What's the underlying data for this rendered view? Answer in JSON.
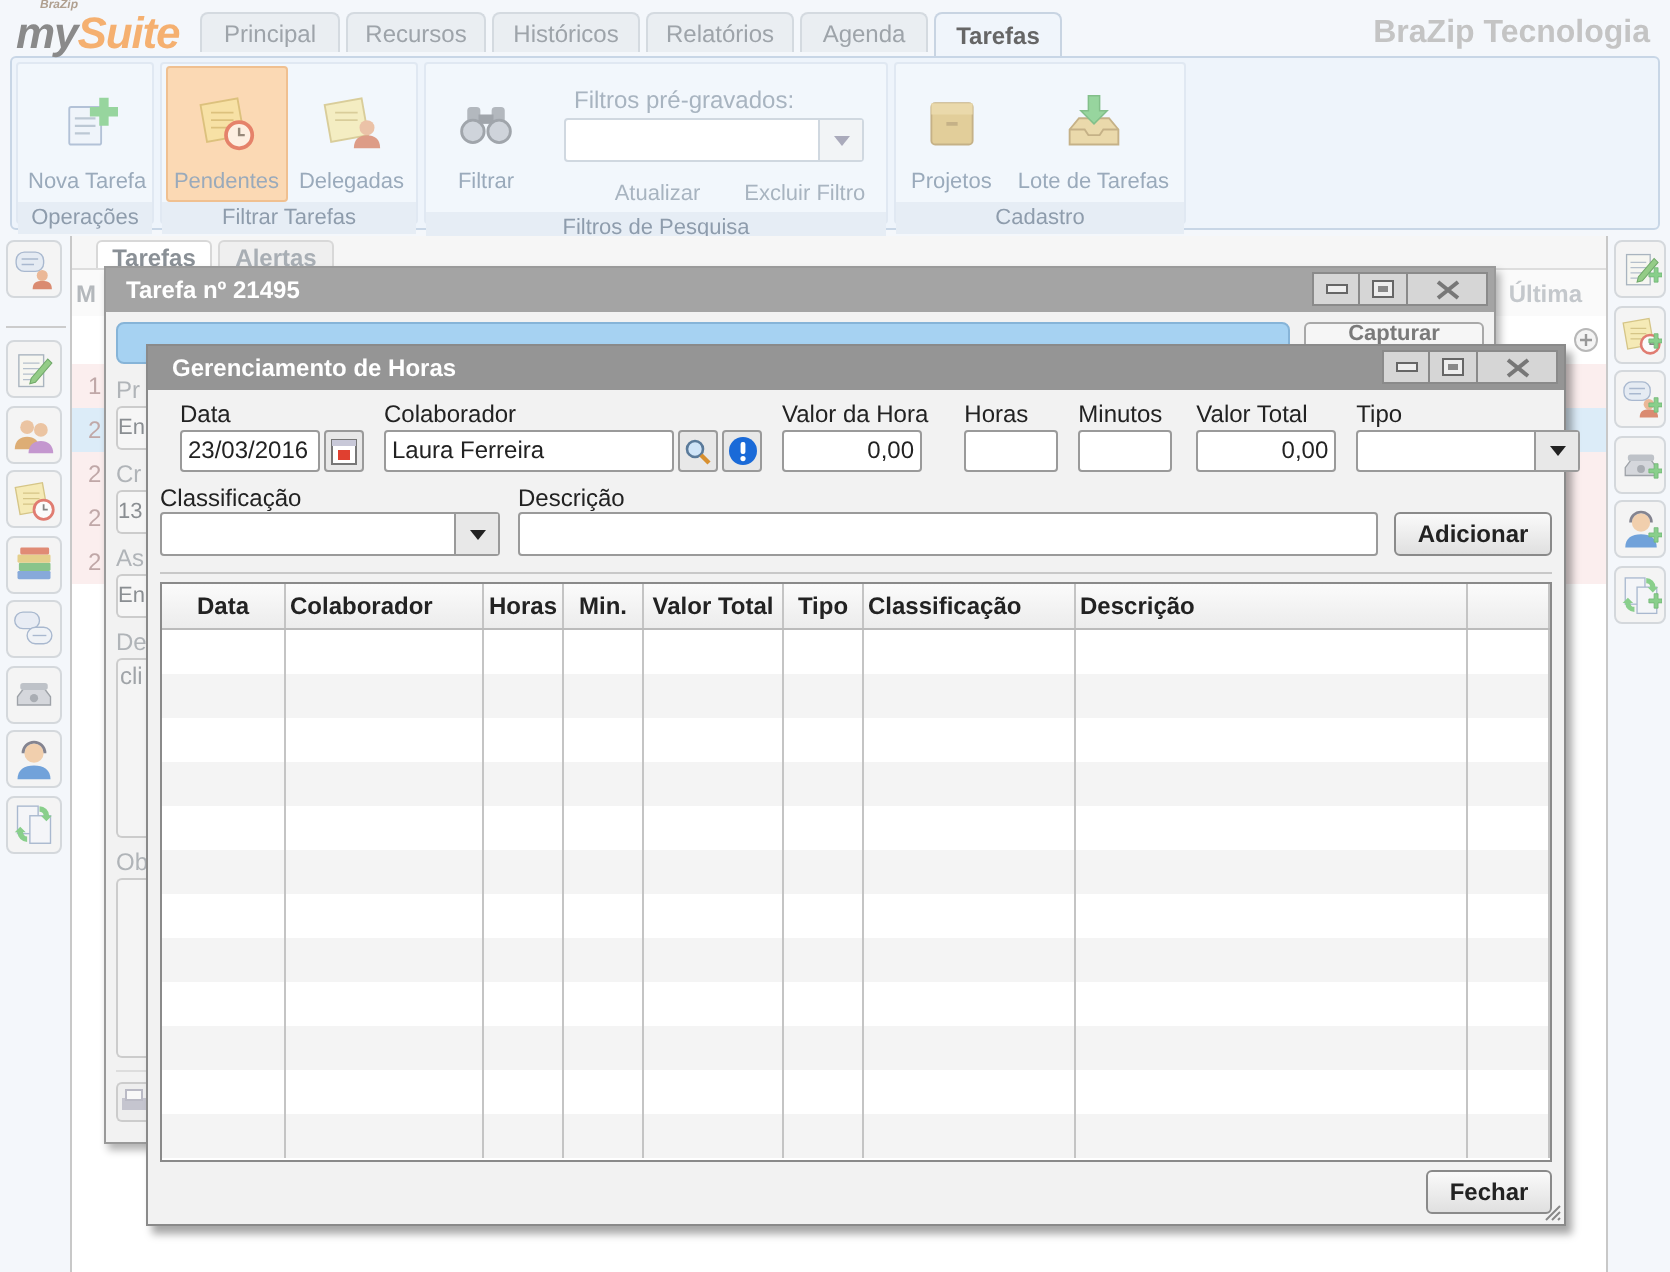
{
  "header": {
    "logo_tag": "BraZip",
    "logo_parts": [
      "my",
      "Suite"
    ],
    "company": "BraZip Tecnologia"
  },
  "tabs": [
    {
      "label": "Principal",
      "selected": false
    },
    {
      "label": "Recursos",
      "selected": false
    },
    {
      "label": "Históricos",
      "selected": false
    },
    {
      "label": "Relatórios",
      "selected": false
    },
    {
      "label": "Agenda",
      "selected": false
    },
    {
      "label": "Tarefas",
      "selected": true
    }
  ],
  "ribbon": {
    "groups": [
      {
        "label": "Operações",
        "items": [
          {
            "kind": "button",
            "label": "Nova Tarefa",
            "selected": false
          }
        ]
      },
      {
        "label": "Filtrar Tarefas",
        "items": [
          {
            "kind": "button",
            "label": "Pendentes",
            "selected": true
          },
          {
            "kind": "button",
            "label": "Delegadas",
            "selected": false
          }
        ]
      },
      {
        "label": "Filtros de Pesquisa",
        "items": [
          {
            "kind": "button",
            "label": "Filtrar",
            "selected": false
          },
          {
            "kind": "filter",
            "label": "Filtros pré-gravados:",
            "links": [
              "Atualizar",
              "Excluir Filtro"
            ]
          }
        ]
      },
      {
        "label": "Cadastro",
        "items": [
          {
            "kind": "button",
            "label": "Projetos",
            "selected": false
          },
          {
            "kind": "button",
            "label": "Lote de Tarefas",
            "selected": false
          }
        ]
      }
    ]
  },
  "task_list": {
    "tabs": [
      {
        "label": "Tarefas",
        "selected": true
      },
      {
        "label": "Alertas",
        "selected": false
      }
    ],
    "column_1": "M",
    "column_last": "Última",
    "rows": [
      {
        "number": "1",
        "selected": false
      },
      {
        "number": "2",
        "selected": true
      },
      {
        "number": "2",
        "selected": false
      },
      {
        "number": "2",
        "selected": false
      },
      {
        "number": "2",
        "selected": false
      }
    ]
  },
  "task_window": {
    "title": "Tarefa nº 21495",
    "capture_button": "Capturar",
    "fields": [
      {
        "kind": "label",
        "text": "Pr"
      },
      {
        "kind": "field",
        "text": "En"
      },
      {
        "kind": "label",
        "text": "Cr"
      },
      {
        "kind": "field",
        "text": "13"
      },
      {
        "kind": "label",
        "text": "As"
      },
      {
        "kind": "field",
        "text": "En"
      },
      {
        "kind": "label",
        "text": "De"
      },
      {
        "kind": "textarea",
        "text": "cli"
      },
      {
        "kind": "label",
        "text": "Ob"
      },
      {
        "kind": "textarea"
      }
    ]
  },
  "hours_dialog": {
    "title": "Gerenciamento de Horas",
    "fields": [
      {
        "kind": "date",
        "label": "Data",
        "value": "23/03/2016"
      },
      {
        "kind": "lookup",
        "label": "Colaborador",
        "value": "Laura Ferreira"
      },
      {
        "kind": "number",
        "label": "Valor da Hora",
        "value": "0,00"
      },
      {
        "kind": "text",
        "label": "Horas"
      },
      {
        "kind": "text",
        "label": "Minutos"
      },
      {
        "kind": "number",
        "label": "Valor Total",
        "value": "0,00"
      },
      {
        "kind": "combo",
        "label": "Tipo"
      }
    ],
    "classification": {
      "label": "Classificação"
    },
    "description": {
      "label": "Descrição"
    },
    "add_button": "Adicionar",
    "table": {
      "columns": [
        "Data",
        "Colaborador",
        "Horas",
        "Min.",
        "Valor Total",
        "Tipo",
        "Classificação",
        "Descrição",
        ""
      ]
    },
    "close_button": "Fechar"
  }
}
